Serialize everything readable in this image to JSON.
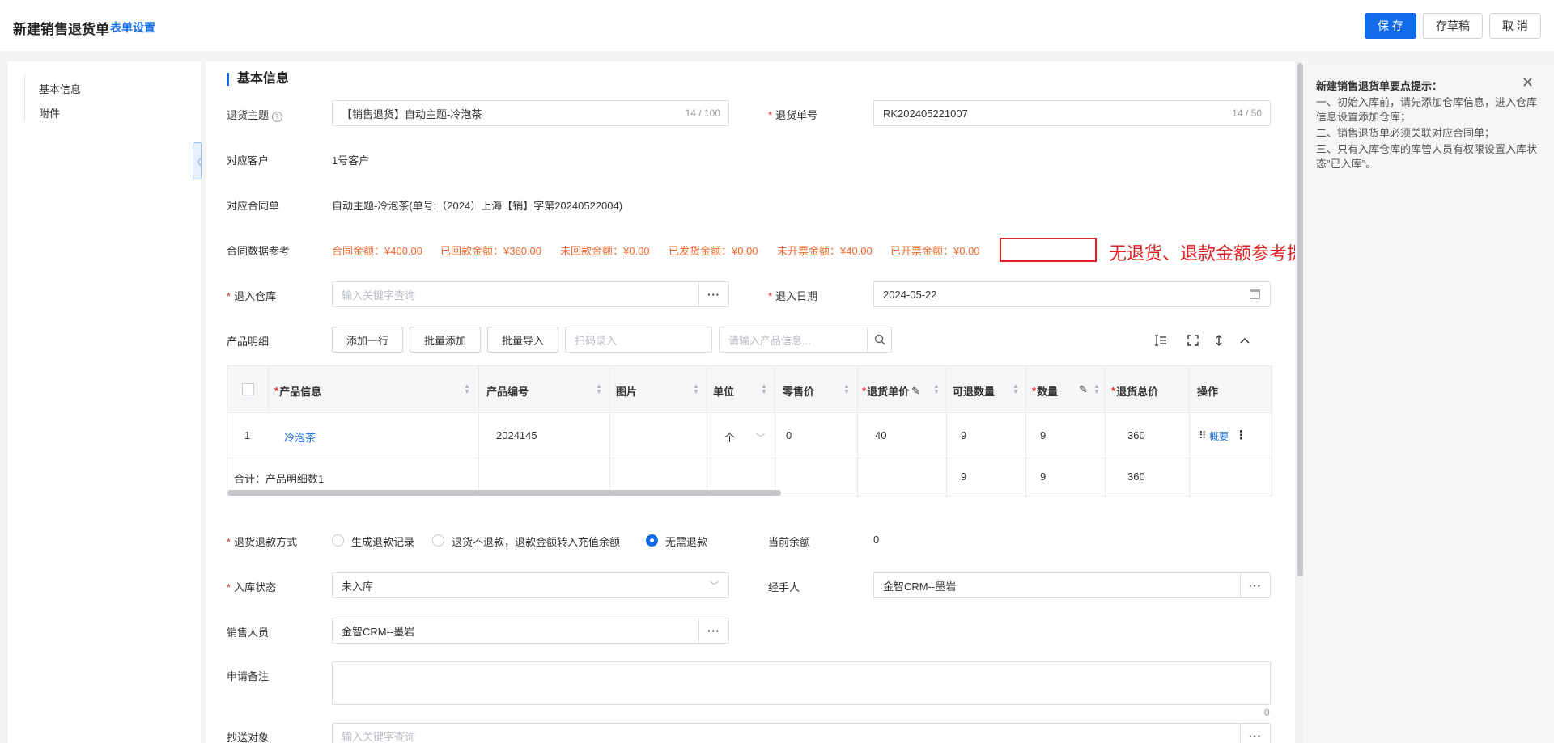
{
  "header": {
    "title": "新建销售退货单",
    "settings_link": "表单设置",
    "save_label": "保 存",
    "draft_label": "存草稿",
    "cancel_label": "取 消"
  },
  "sidebar": {
    "items": [
      {
        "label": "基本信息"
      },
      {
        "label": "附件"
      }
    ]
  },
  "form": {
    "section_title": "基本信息",
    "subject": {
      "label": "退货主题",
      "value": "【销售退货】自动主题-冷泡茶",
      "count": "14 / 100"
    },
    "return_no": {
      "label": "退货单号",
      "value": "RK202405221007",
      "count": "14 / 50"
    },
    "customer": {
      "label": "对应客户",
      "value": "1号客户"
    },
    "contract": {
      "label": "对应合同单",
      "value": "自动主题-冷泡茶(单号:（2024）上海【销】字第20240522004)"
    },
    "contract_ref": {
      "label": "合同数据参考",
      "items": [
        "合同金额：¥400.00",
        "已回款金额：¥360.00",
        "未回款金额：¥0.00",
        "已发货金额：¥0.00",
        "未开票金额：¥40.00",
        "已开票金额：¥0.00"
      ]
    },
    "warehouse": {
      "label": "退入仓库",
      "placeholder": "输入关键字查询"
    },
    "return_date": {
      "label": "退入日期",
      "value": "2024-05-22"
    },
    "products": {
      "label": "产品明细",
      "add_row": "添加一行",
      "batch_add": "批量添加",
      "batch_import": "批量导入",
      "scan_placeholder": "扫码录入",
      "search_placeholder": "请输入产品信息..."
    },
    "refund_method": {
      "label": "退货退款方式",
      "options": [
        "生成退款记录",
        "退货不退款，退款金额转入充值余额",
        "无需退款"
      ],
      "selected": "无需退款"
    },
    "balance": {
      "label": "当前余额",
      "value": "0"
    },
    "stock_status": {
      "label": "入库状态",
      "value": "未入库"
    },
    "handler": {
      "label": "经手人",
      "value": "金智CRM--墨岩"
    },
    "salesperson": {
      "label": "销售人员",
      "value": "金智CRM--墨岩"
    },
    "remark": {
      "label": "申请备注",
      "count": "0"
    },
    "cc": {
      "label": "抄送对象",
      "placeholder": "输入关键字查询"
    }
  },
  "table": {
    "headers": [
      "产品信息",
      "产品编号",
      "图片",
      "单位",
      "零售价",
      "退货单价",
      "可退数量",
      "数量",
      "退货总价",
      "操作"
    ],
    "rows": [
      {
        "index": "1",
        "product": "冷泡茶",
        "code": "2024145",
        "image": "",
        "unit": "个",
        "retail": "0",
        "price": "40",
        "returnable": "9",
        "qty": "9",
        "total": "360",
        "action": "概要"
      }
    ],
    "summary": {
      "label": "合计：产品明细数1",
      "returnable": "9",
      "qty": "9",
      "total": "360"
    }
  },
  "tips": {
    "title": "新建销售退货单要点提示：",
    "items": [
      "一、初始入库前，请先添加仓库信息，进入仓库信息设置添加仓库；",
      "二、销售退货单必须关联对应合同单；",
      "三、只有入库仓库的库管人员有权限设置入库状态\"已入库\"。"
    ]
  },
  "annotation": {
    "text": "无退货、退款金额参考提取",
    "color": "#e02020"
  },
  "colors": {
    "primary": "#0f6be8",
    "warning": "#f0672b",
    "required": "#e0322b"
  }
}
